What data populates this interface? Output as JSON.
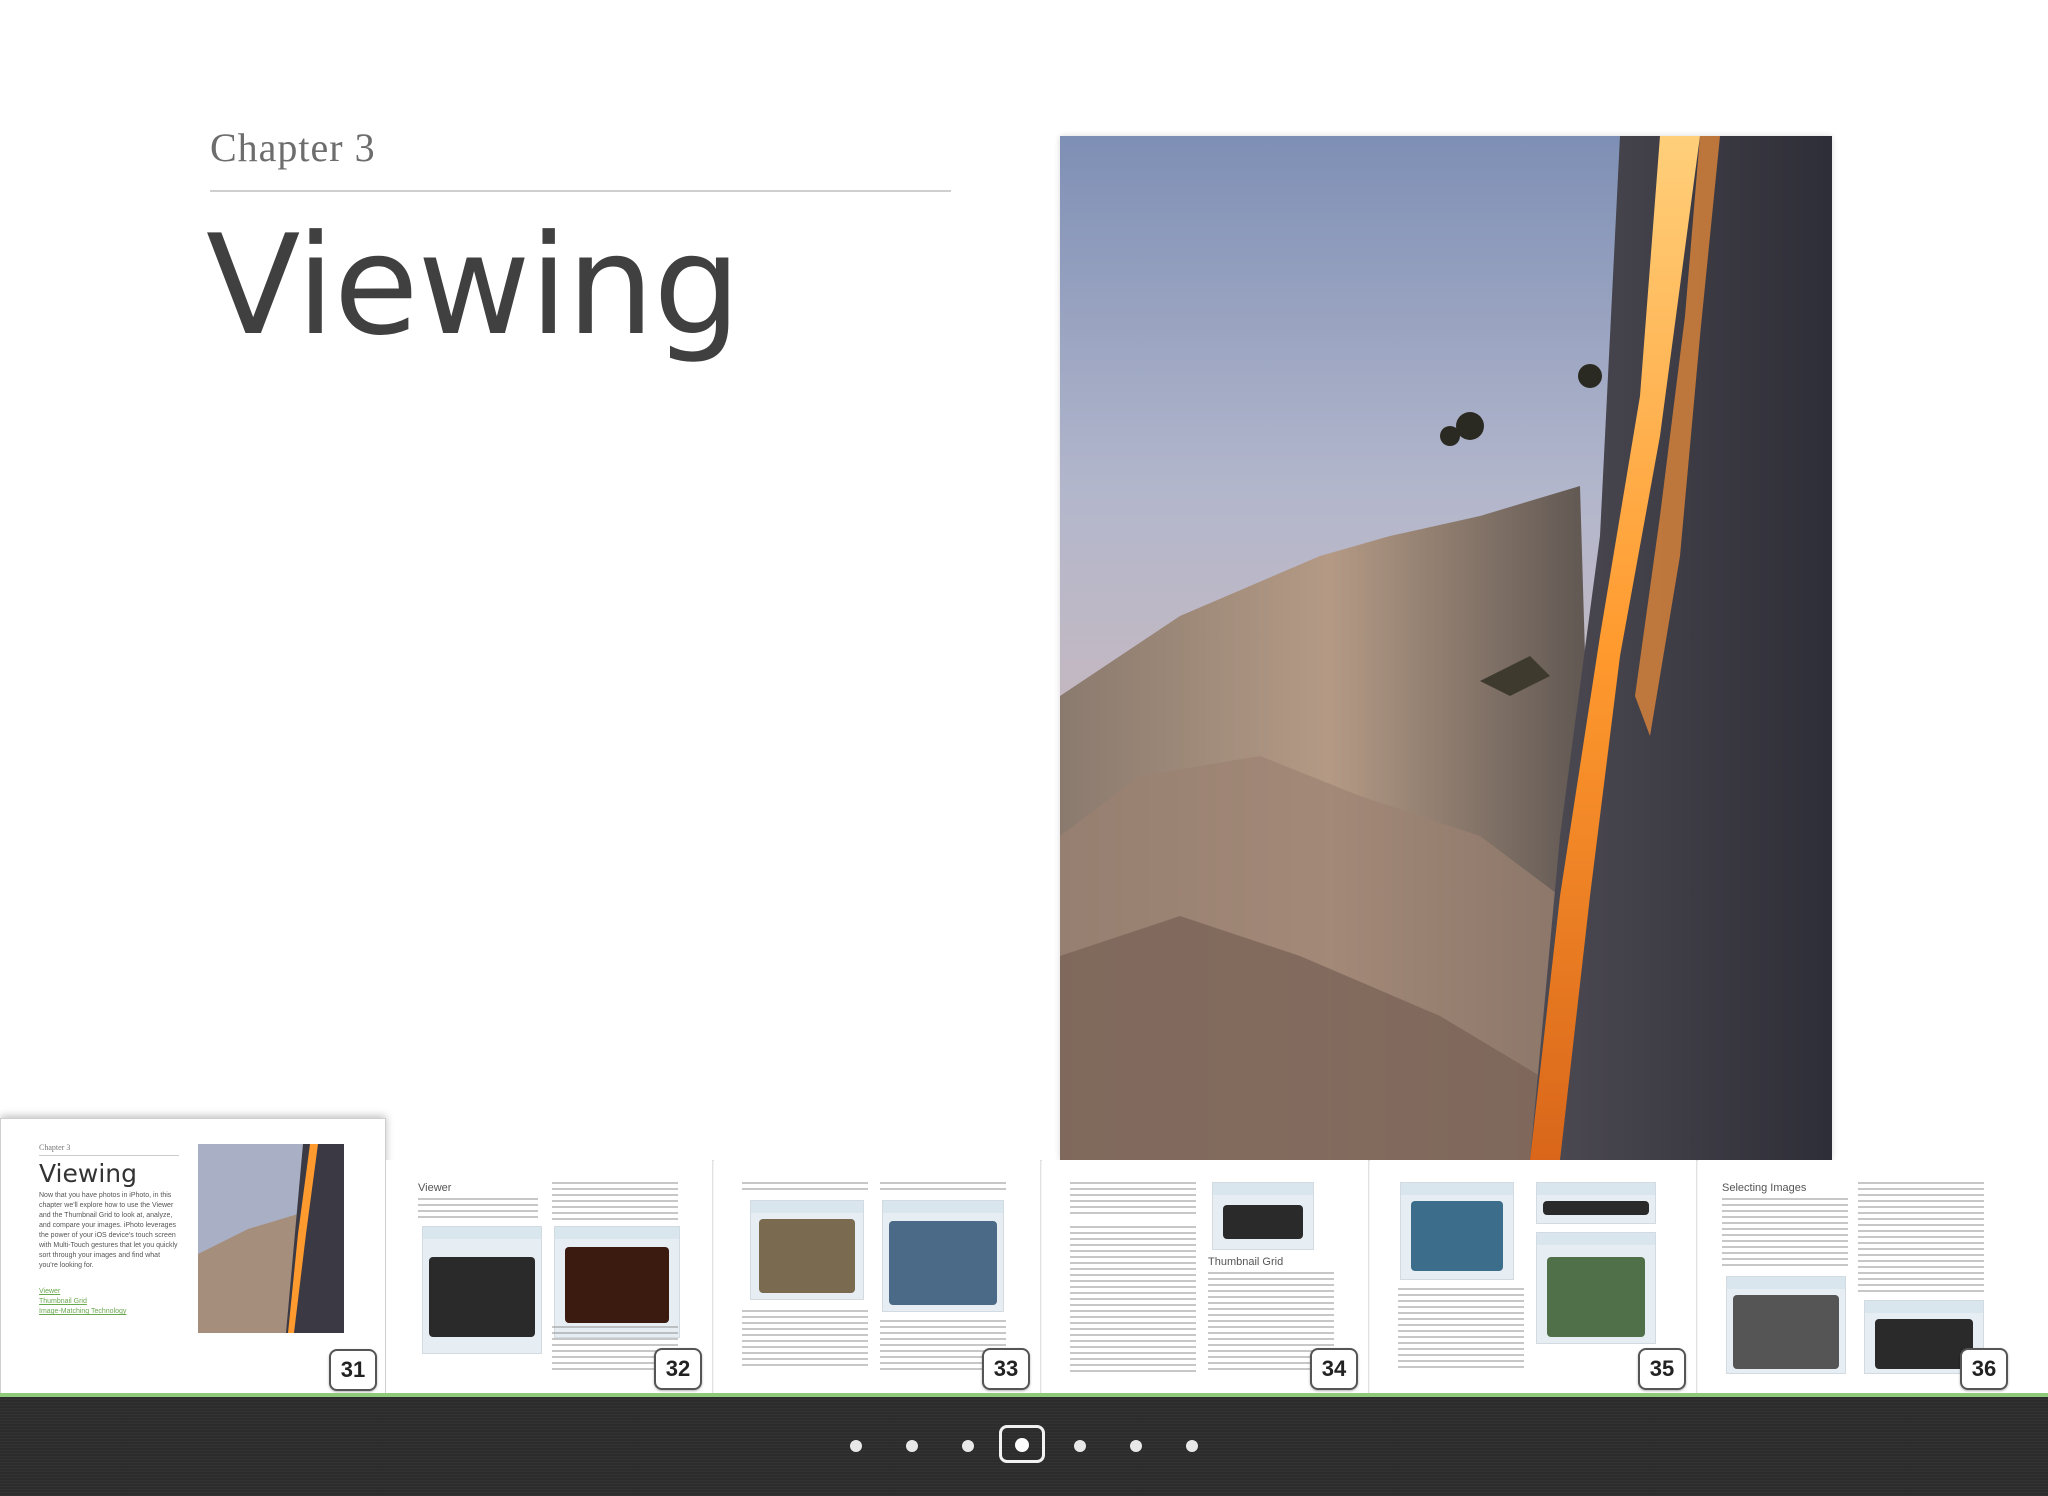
{
  "page": {
    "chapter_label": "Chapter 3",
    "chapter_title": "Viewing"
  },
  "thumbnails": [
    {
      "page": "31",
      "current": true,
      "chapter_label": "Chapter 3",
      "title": "Viewing",
      "body": "Now that you have photos in iPhoto, in this chapter we'll explore how to use the Viewer and the Thumbnail Grid to look at, analyze, and compare your images. iPhoto leverages the power of your iOS device's touch screen with Multi-Touch gestures that let you quickly sort through your images and find what you're looking for.",
      "links": [
        "Viewer",
        "Thumbnail Grid",
        "Image-Matching Technology"
      ]
    },
    {
      "page": "32",
      "heading": "Viewer"
    },
    {
      "page": "33"
    },
    {
      "page": "34",
      "heading": "Thumbnail Grid"
    },
    {
      "page": "35"
    },
    {
      "page": "36",
      "heading": "Selecting Images"
    }
  ],
  "pager": {
    "dot_count": 7,
    "current_index": 3
  },
  "colors": {
    "toolbar": "#2c2c2c",
    "accent_green": "#8fc97a",
    "title_text": "#404040"
  }
}
